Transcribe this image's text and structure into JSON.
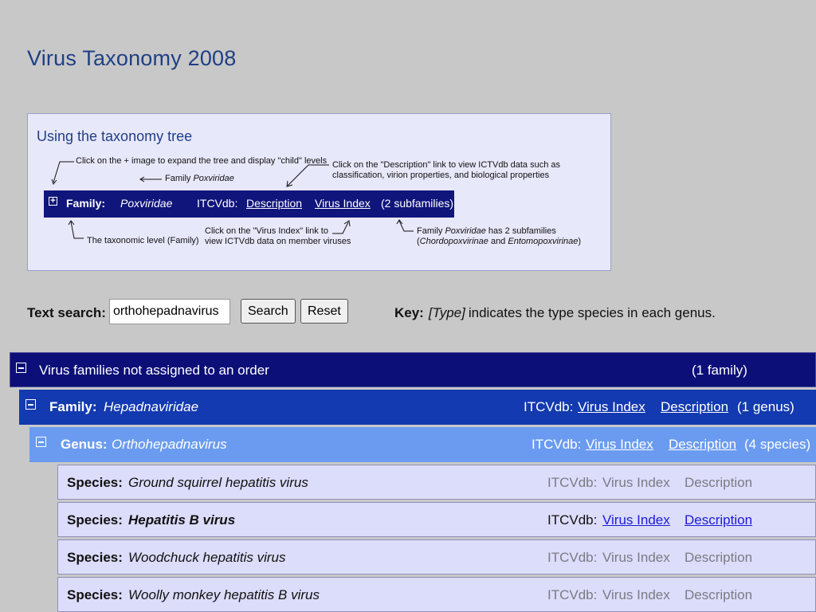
{
  "page": {
    "title": "Virus Taxonomy 2008"
  },
  "help": {
    "heading": "Using the taxonomy tree",
    "note_expand": "Click on the + image to expand the tree and display \"child\" levels",
    "note_family_prefix": "Family ",
    "note_family_name": "Poxviridae",
    "note_desc_line1": "Click on the \"Description\" link to view ICTVdb data such as",
    "note_desc_line2": "classification, virion properties, and biological properties",
    "note_level": "The taxonomic level (Family)",
    "note_index_line1": "Click on the \"Virus Index\" link to",
    "note_index_line2": "view ICTVdb data on member viruses",
    "note_sub_prefix": "Family ",
    "note_sub_name": "Poxviridae",
    "note_sub_suffix": " has 2 subfamilies",
    "note_sub_line2_open": "(",
    "note_sub_name2": "Chordopoxvirinae",
    "note_sub_and": " and ",
    "note_sub_name3": "Entomopoxvirinae",
    "note_sub_close": ")",
    "example": {
      "label": "Family:",
      "name": "Poxviridae",
      "db": "ITCVdb:",
      "description": "Description",
      "virus_index": "Virus Index",
      "count": "(2 subfamilies)"
    }
  },
  "search": {
    "label": "Text search:",
    "value": "orthohepadnavirus",
    "search_button": "Search",
    "reset_button": "Reset"
  },
  "key": {
    "label": "Key:",
    "type": "[Type]",
    "text": "indicates the type species in each genus."
  },
  "tree": {
    "order": {
      "label": "Virus families not assigned to an order",
      "count": "(1 family)"
    },
    "family": {
      "label": "Family:",
      "name": "Hepadnaviridae",
      "db": "ITCVdb:",
      "virus_index": "Virus Index",
      "description": "Description",
      "count": "(1 genus)"
    },
    "genus": {
      "label": "Genus:",
      "name": "Orthohepadnavirus",
      "db": "ITCVdb:",
      "virus_index": "Virus Index",
      "description": "Description",
      "count": "(4 species)"
    },
    "species": [
      {
        "label": "Species:",
        "name": "Ground squirrel hepatitis virus",
        "db": "ITCVdb:",
        "virus_index": "Virus Index",
        "description": "Description"
      },
      {
        "label": "Species:",
        "name": "Hepatitis B virus",
        "db": "ITCVdb:",
        "virus_index": "Virus Index",
        "description": "Description"
      },
      {
        "label": "Species:",
        "name": "Woodchuck hepatitis virus",
        "db": "ITCVdb:",
        "virus_index": "Virus Index",
        "description": "Description"
      },
      {
        "label": "Species:",
        "name": "Woolly monkey hepatitis B virus",
        "db": "ITCVdb:",
        "virus_index": "Virus Index",
        "description": "Description"
      }
    ]
  }
}
